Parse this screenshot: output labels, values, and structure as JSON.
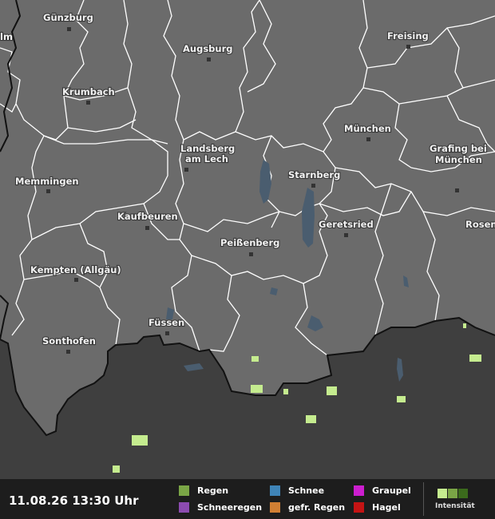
{
  "map": {
    "cities": [
      {
        "name": "Günzburg"
      },
      {
        "name": "Augsburg"
      },
      {
        "name": "Freising"
      },
      {
        "name": "Krumbach"
      },
      {
        "name": "München"
      },
      {
        "name": "Landsberg am Lech"
      },
      {
        "name": "Grafing bei München"
      },
      {
        "name": "Memmingen"
      },
      {
        "name": "Starnberg"
      },
      {
        "name": "Kaufbeuren"
      },
      {
        "name": "Geretsried"
      },
      {
        "name": "Rosenheim (cut)"
      },
      {
        "name": "Peißenberg"
      },
      {
        "name": "Kempten (Allgäu)"
      },
      {
        "name": "Füssen"
      },
      {
        "name": "Sonthofen"
      },
      {
        "name": "Ulm (cut)"
      }
    ],
    "colors": {
      "germany_fill": "#6b6b6b",
      "outside_fill": "#3f3f3f",
      "district_border": "#ffffff",
      "country_border": "#111111",
      "lake": "#4a5d6f",
      "precip_light": "#c5ec8f"
    }
  },
  "footer": {
    "timestamp": "11.08.26 13:30 Uhr",
    "legend": [
      {
        "label": "Regen",
        "color": "#7aa546"
      },
      {
        "label": "Schneeregen",
        "color": "#8c4bb0"
      },
      {
        "label": "Schnee",
        "color": "#3f84b7"
      },
      {
        "label": "gefr. Regen",
        "color": "#d07f33"
      },
      {
        "label": "Graupel",
        "color": "#cc1ecf"
      },
      {
        "label": "Hagel",
        "color": "#c41414"
      }
    ],
    "intensity": {
      "label": "Intensität",
      "colors": [
        "#c5ec8f",
        "#7aa546",
        "#3b6a1c"
      ]
    }
  }
}
